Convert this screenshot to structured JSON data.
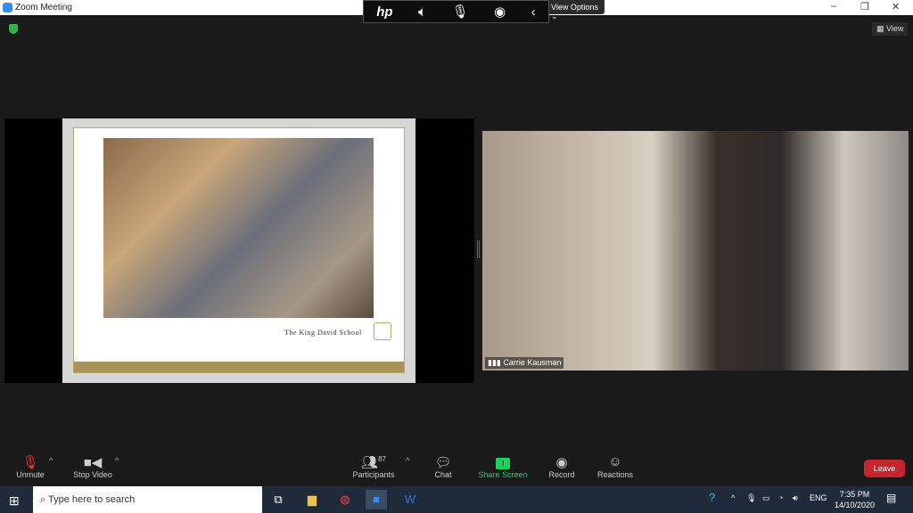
{
  "window": {
    "title": "Zoom Meeting",
    "minimize": "–",
    "restore": "❐",
    "close": "✕"
  },
  "hp_toolbar": {
    "logo": "hp",
    "items": [
      "speaker-icon",
      "mic-icon",
      "broadcast-icon",
      "chevron-left-icon"
    ]
  },
  "view_options": "View Options ⌄",
  "view_button": "View",
  "share": {
    "school_name": "The King David School"
  },
  "participant_video": {
    "name": "Carrie Kausman"
  },
  "toolbar": {
    "unmute": "Unmute",
    "stop_video": "Stop Video",
    "participants": "Participants",
    "participant_count": "87",
    "chat": "Chat",
    "share_screen": "Share Screen",
    "record": "Record",
    "reactions": "Reactions",
    "leave": "Leave"
  },
  "taskbar": {
    "search_placeholder": "Type here to search",
    "language": "ENG",
    "time": "7:35 PM",
    "date": "14/10/2020"
  },
  "colors": {
    "share_green": "#1fd05a",
    "leave_red": "#c4262e",
    "shield_green": "#2fb34a"
  }
}
